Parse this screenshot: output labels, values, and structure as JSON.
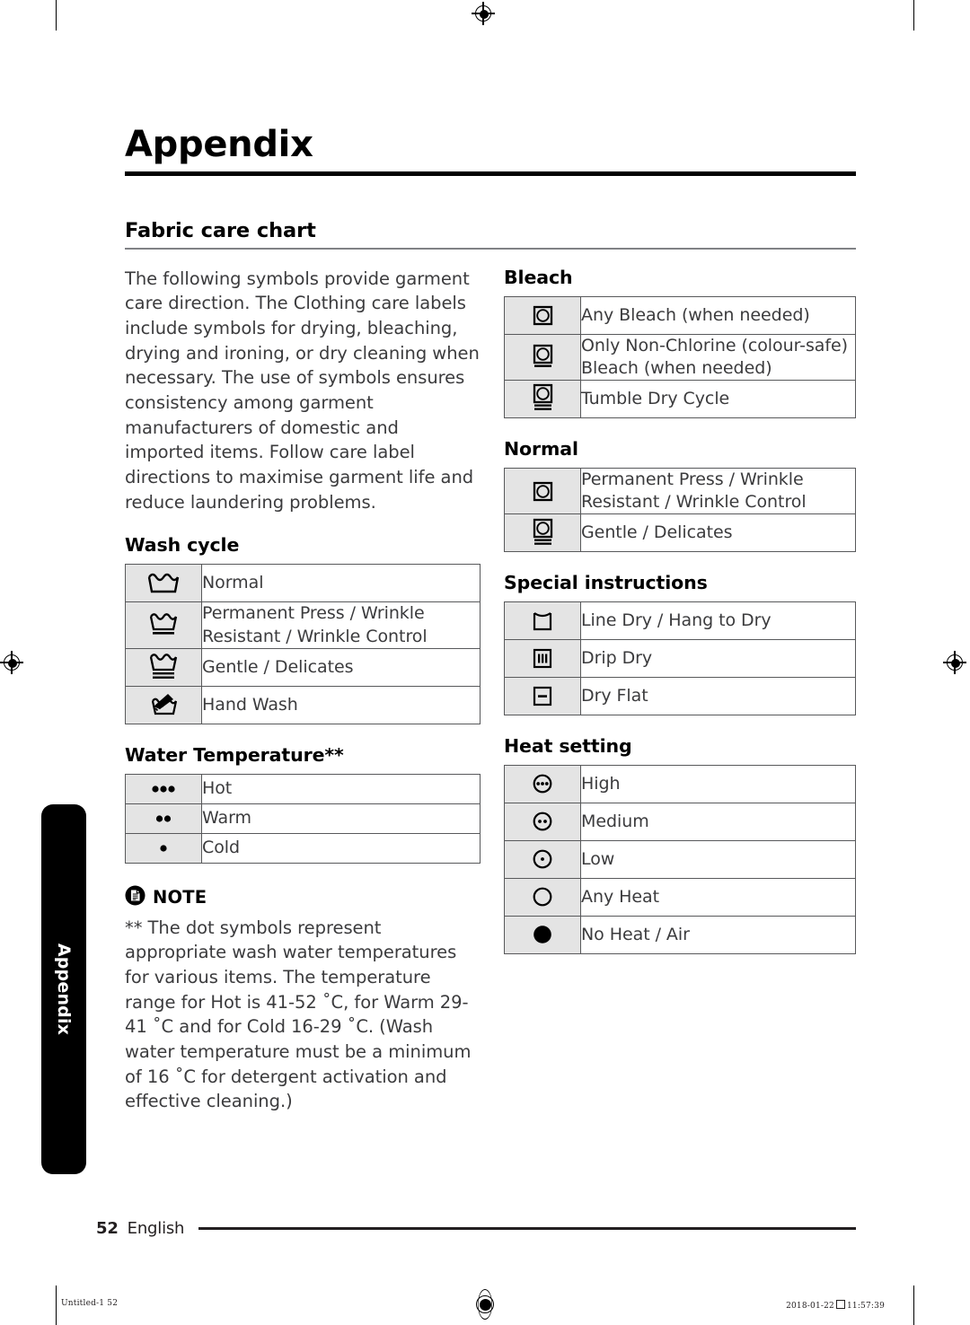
{
  "chapter": {
    "title": "Appendix"
  },
  "section": {
    "title": "Fabric care chart"
  },
  "intro": {
    "paragraph": "The following symbols provide garment care direction. The Clothing care labels include symbols for drying, bleaching, drying and ironing, or dry cleaning when necessary. The use of symbols ensures consistency among garment manufacturers of domestic and imported items. Follow care label directions to maximise garment life and reduce laundering problems."
  },
  "tables": {
    "wash_cycle": {
      "heading": "Wash cycle",
      "rows": [
        {
          "symbol": "wash-tub-icon",
          "label": "Normal"
        },
        {
          "symbol": "wash-tub-one-bar-icon",
          "label": "Permanent Press / Wrinkle Resistant / Wrinkle Control"
        },
        {
          "symbol": "wash-tub-two-bar-icon",
          "label": "Gentle / Delicates"
        },
        {
          "symbol": "hand-wash-icon",
          "label": "Hand Wash"
        }
      ]
    },
    "water_temperature": {
      "heading": "Water Temperature**",
      "rows": [
        {
          "symbol": "three-dots-icon",
          "label": "Hot"
        },
        {
          "symbol": "two-dots-icon",
          "label": "Warm"
        },
        {
          "symbol": "one-dot-icon",
          "label": "Cold"
        }
      ]
    },
    "bleach": {
      "heading": "Bleach",
      "rows": [
        {
          "symbol": "dryer-square-icon",
          "label": "Any Bleach (when needed)"
        },
        {
          "symbol": "dryer-square-one-bar-icon",
          "label": "Only Non-Chlorine (colour-safe) Bleach (when needed)"
        },
        {
          "symbol": "dryer-square-two-bar-icon",
          "label": "Tumble Dry Cycle"
        }
      ]
    },
    "normal": {
      "heading": "Normal",
      "rows": [
        {
          "symbol": "dryer-square-icon",
          "label": "Permanent Press / Wrinkle Resistant / Wrinkle Control"
        },
        {
          "symbol": "dryer-square-two-bar-icon",
          "label": "Gentle / Delicates"
        }
      ]
    },
    "special_instructions": {
      "heading": "Special instructions",
      "rows": [
        {
          "symbol": "line-dry-icon",
          "label": "Line Dry / Hang to Dry"
        },
        {
          "symbol": "drip-dry-icon",
          "label": "Drip Dry"
        },
        {
          "symbol": "dry-flat-icon",
          "label": "Dry Flat"
        }
      ]
    },
    "heat_setting": {
      "heading": "Heat setting",
      "rows": [
        {
          "symbol": "circle-three-dots-icon",
          "label": "High"
        },
        {
          "symbol": "circle-two-dots-icon",
          "label": "Medium"
        },
        {
          "symbol": "circle-one-dot-icon",
          "label": "Low"
        },
        {
          "symbol": "circle-empty-icon",
          "label": "Any Heat"
        },
        {
          "symbol": "circle-filled-icon",
          "label": "No Heat / Air"
        }
      ]
    }
  },
  "note": {
    "icon": "note-document-icon",
    "label": "NOTE",
    "text": "** The dot symbols represent appropriate wash water temperatures for various items. The temperature range for Hot is 41-52 ˚C, for Warm 29-41 ˚C and for Cold 16-29 ˚C. (Wash water temperature must be a minimum of 16 ˚C for detergent activation and effective cleaning.)"
  },
  "side_tab": {
    "label": "Appendix"
  },
  "footer": {
    "page_number": "52",
    "language": "English"
  },
  "print_slug": {
    "left": "Untitled-1   52",
    "date": "2018-01-22",
    "time": "11:57:39"
  }
}
